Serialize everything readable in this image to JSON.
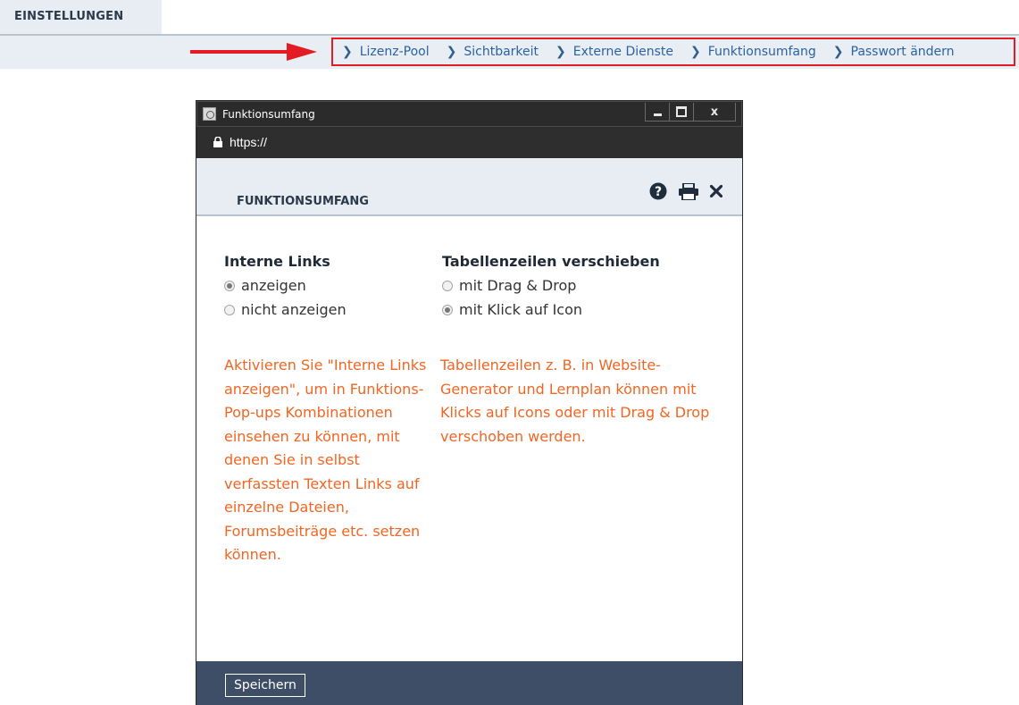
{
  "page": {
    "section_title": "EINSTELLUNGEN"
  },
  "nav": {
    "items": [
      {
        "label": "Lizenz-Pool"
      },
      {
        "label": "Sichtbarkeit"
      },
      {
        "label": "Externe Dienste"
      },
      {
        "label": "Funktionsumfang"
      },
      {
        "label": "Passwort ändern"
      }
    ],
    "highlight_color": "#e31b23",
    "link_color": "#2a62a2"
  },
  "window": {
    "title": "Funktionsumfang",
    "url": "https://",
    "controls": {
      "minimize": "minimize-icon",
      "maximize": "maximize-icon",
      "close_label": "x"
    }
  },
  "dialog": {
    "title": "FUNKTIONSUMFANG",
    "tools": [
      "question-circle-icon",
      "print-icon",
      "close-icon"
    ]
  },
  "sections": {
    "internal_links": {
      "title": "Interne Links",
      "options": [
        {
          "label": "anzeigen",
          "selected": true
        },
        {
          "label": "nicht anzeigen",
          "selected": false
        }
      ],
      "help": "Aktivieren Sie \"Interne Links anzeigen\", um in Funktions-Pop-ups Kombinationen einsehen zu können, mit denen Sie in selbst verfassten Texten Links auf einzelne Dateien, Forumsbeiträge etc. setzen können."
    },
    "move_rows": {
      "title": "Tabellenzeilen verschieben",
      "options": [
        {
          "label": "mit Drag & Drop",
          "selected": false
        },
        {
          "label": "mit Klick auf Icon",
          "selected": true
        }
      ],
      "help": "Tabellenzeilen z. B. in Website-Generator und Lernplan können mit Klicks auf Icons oder mit Drag & Drop verschoben werden."
    }
  },
  "footer": {
    "save_label": "Speichern",
    "background": "#3d4e66"
  },
  "colors": {
    "help_text": "#f26522",
    "header_bg": "#e8edf3"
  }
}
